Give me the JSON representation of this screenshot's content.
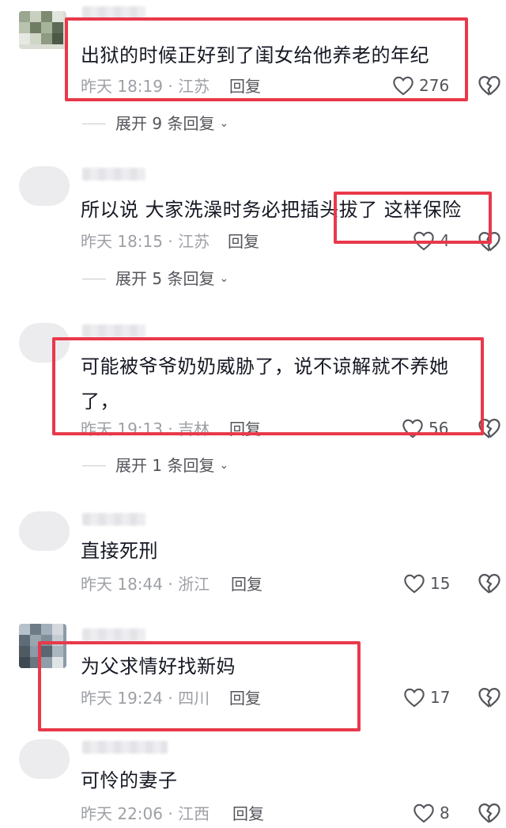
{
  "comments": [
    {
      "text": "出狱的时候正好到了闺女给他养老的年纪",
      "time": "昨天 18:19 · 江苏",
      "reply_label": "回复",
      "likes": "276",
      "expand": "展开 9 条回复"
    },
    {
      "text": "所以说 大家洗澡时务必把插头拔了 这样保险",
      "time": "昨天 18:15 · 江苏",
      "reply_label": "回复",
      "likes": "4",
      "expand": "展开 5 条回复"
    },
    {
      "text_line1": "可能被爷爷奶奶威胁了，说不谅解就不养她",
      "text_line2": "了，",
      "time": "昨天 19:13 · 吉林",
      "reply_label": "回复",
      "likes": "56",
      "expand": "展开 1 条回复"
    },
    {
      "text": "直接死刑",
      "time": "昨天 18:44 · 浙江",
      "reply_label": "回复",
      "likes": "15"
    },
    {
      "text": "为父求情好找新妈",
      "time": "昨天 19:24 · 四川",
      "reply_label": "回复",
      "likes": "17"
    },
    {
      "text": "可怜的妻子",
      "time": "昨天 22:06 · 江西",
      "reply_label": "回复",
      "likes": "8"
    }
  ],
  "colors": {
    "highlight": "#e8394a",
    "text": "#161823",
    "meta": "#9ea0a6"
  },
  "icons": [
    "heart-outline-icon",
    "broken-heart-icon",
    "chevron-down-icon"
  ]
}
